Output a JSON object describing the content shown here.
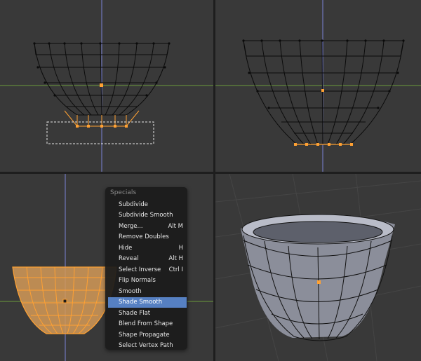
{
  "app": "3D viewport (mesh edit mode)",
  "viewports": [
    {
      "id": "top-left",
      "mode": "edit",
      "selection": "bottom ring selected with box select"
    },
    {
      "id": "top-right",
      "mode": "edit",
      "selection": "bottom ring selected"
    },
    {
      "id": "bottom-left",
      "mode": "edit",
      "selection": "all selected"
    },
    {
      "id": "bottom-right",
      "mode": "edit",
      "view": "perspective, smooth shaded"
    }
  ],
  "specials_menu": {
    "title": "Specials",
    "items": [
      {
        "label": "Subdivide",
        "shortcut": ""
      },
      {
        "label": "Subdivide Smooth",
        "shortcut": ""
      },
      {
        "label": "Merge...",
        "shortcut": "Alt M"
      },
      {
        "label": "Remove Doubles",
        "shortcut": ""
      },
      {
        "label": "Hide",
        "shortcut": "H"
      },
      {
        "label": "Reveal",
        "shortcut": "Alt H"
      },
      {
        "label": "Select Inverse",
        "shortcut": "Ctrl I"
      },
      {
        "label": "Flip Normals",
        "shortcut": ""
      },
      {
        "label": "Smooth",
        "shortcut": ""
      },
      {
        "label": "Shade Smooth",
        "shortcut": "",
        "highlighted": true
      },
      {
        "label": "Shade Flat",
        "shortcut": ""
      },
      {
        "label": "Blend From Shape",
        "shortcut": ""
      },
      {
        "label": "Shape Propagate",
        "shortcut": ""
      },
      {
        "label": "Select Vertex Path",
        "shortcut": ""
      }
    ]
  },
  "colors": {
    "background": "#393939",
    "wire": "#0b0b0b",
    "selected": "#ffa133",
    "x_axis": "#6c9a3a",
    "y_axis": "#7a82d6",
    "menu_highlight": "#5680c2"
  }
}
